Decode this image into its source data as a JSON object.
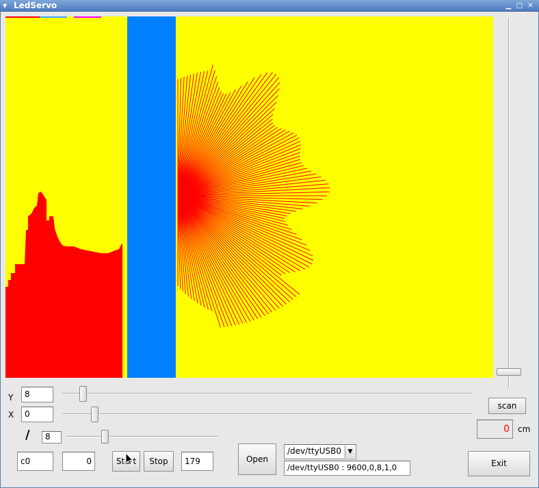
{
  "window": {
    "title": "LedServo",
    "menu_icon": "triangle-down-icon",
    "minimize_icon": "minimize-icon",
    "maximize_icon": "maximize-icon",
    "close_icon": "close-icon"
  },
  "colors": {
    "canvas_bg": "#ffff00",
    "plot_red": "#ff0000",
    "stripe_blue": "#0080ff",
    "distance_text": "#ff0000"
  },
  "controls": {
    "y_label": "Y",
    "y_value": "8",
    "y_slider_level": 0.05,
    "x_label": "X",
    "x_value": "0",
    "x_slider_level": 0.08,
    "slash_label": "/",
    "slash_value": "8",
    "slash_slider_level": 0.25,
    "vertical_slider_level": 1.0
  },
  "bottom": {
    "field1": "c0",
    "field2": "0",
    "start_label": "Start",
    "stop_label": "Stop",
    "field3": "179",
    "open_label": "Open",
    "port_selected": "/dev/ttyUSB0",
    "port_status": "/dev/ttyUSB0 : 9600,0,8,1,0",
    "scan_label": "scan",
    "distance_value": "0",
    "distance_unit": "cm",
    "exit_label": "Exit"
  }
}
